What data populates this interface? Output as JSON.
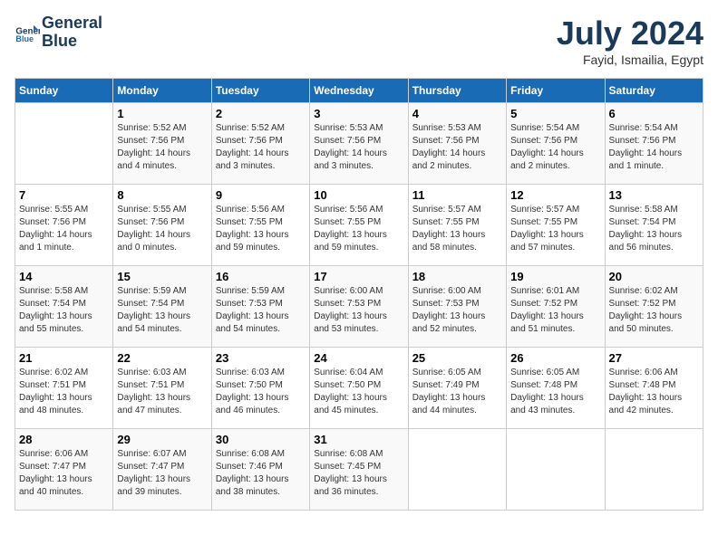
{
  "header": {
    "logo_line1": "General",
    "logo_line2": "Blue",
    "month": "July 2024",
    "location": "Fayid, Ismailia, Egypt"
  },
  "columns": [
    "Sunday",
    "Monday",
    "Tuesday",
    "Wednesday",
    "Thursday",
    "Friday",
    "Saturday"
  ],
  "weeks": [
    [
      {
        "day": "",
        "info": ""
      },
      {
        "day": "1",
        "info": "Sunrise: 5:52 AM\nSunset: 7:56 PM\nDaylight: 14 hours\nand 4 minutes."
      },
      {
        "day": "2",
        "info": "Sunrise: 5:52 AM\nSunset: 7:56 PM\nDaylight: 14 hours\nand 3 minutes."
      },
      {
        "day": "3",
        "info": "Sunrise: 5:53 AM\nSunset: 7:56 PM\nDaylight: 14 hours\nand 3 minutes."
      },
      {
        "day": "4",
        "info": "Sunrise: 5:53 AM\nSunset: 7:56 PM\nDaylight: 14 hours\nand 2 minutes."
      },
      {
        "day": "5",
        "info": "Sunrise: 5:54 AM\nSunset: 7:56 PM\nDaylight: 14 hours\nand 2 minutes."
      },
      {
        "day": "6",
        "info": "Sunrise: 5:54 AM\nSunset: 7:56 PM\nDaylight: 14 hours\nand 1 minute."
      }
    ],
    [
      {
        "day": "7",
        "info": "Sunrise: 5:55 AM\nSunset: 7:56 PM\nDaylight: 14 hours\nand 1 minute."
      },
      {
        "day": "8",
        "info": "Sunrise: 5:55 AM\nSunset: 7:56 PM\nDaylight: 14 hours\nand 0 minutes."
      },
      {
        "day": "9",
        "info": "Sunrise: 5:56 AM\nSunset: 7:55 PM\nDaylight: 13 hours\nand 59 minutes."
      },
      {
        "day": "10",
        "info": "Sunrise: 5:56 AM\nSunset: 7:55 PM\nDaylight: 13 hours\nand 59 minutes."
      },
      {
        "day": "11",
        "info": "Sunrise: 5:57 AM\nSunset: 7:55 PM\nDaylight: 13 hours\nand 58 minutes."
      },
      {
        "day": "12",
        "info": "Sunrise: 5:57 AM\nSunset: 7:55 PM\nDaylight: 13 hours\nand 57 minutes."
      },
      {
        "day": "13",
        "info": "Sunrise: 5:58 AM\nSunset: 7:54 PM\nDaylight: 13 hours\nand 56 minutes."
      }
    ],
    [
      {
        "day": "14",
        "info": "Sunrise: 5:58 AM\nSunset: 7:54 PM\nDaylight: 13 hours\nand 55 minutes."
      },
      {
        "day": "15",
        "info": "Sunrise: 5:59 AM\nSunset: 7:54 PM\nDaylight: 13 hours\nand 54 minutes."
      },
      {
        "day": "16",
        "info": "Sunrise: 5:59 AM\nSunset: 7:53 PM\nDaylight: 13 hours\nand 54 minutes."
      },
      {
        "day": "17",
        "info": "Sunrise: 6:00 AM\nSunset: 7:53 PM\nDaylight: 13 hours\nand 53 minutes."
      },
      {
        "day": "18",
        "info": "Sunrise: 6:00 AM\nSunset: 7:53 PM\nDaylight: 13 hours\nand 52 minutes."
      },
      {
        "day": "19",
        "info": "Sunrise: 6:01 AM\nSunset: 7:52 PM\nDaylight: 13 hours\nand 51 minutes."
      },
      {
        "day": "20",
        "info": "Sunrise: 6:02 AM\nSunset: 7:52 PM\nDaylight: 13 hours\nand 50 minutes."
      }
    ],
    [
      {
        "day": "21",
        "info": "Sunrise: 6:02 AM\nSunset: 7:51 PM\nDaylight: 13 hours\nand 48 minutes."
      },
      {
        "day": "22",
        "info": "Sunrise: 6:03 AM\nSunset: 7:51 PM\nDaylight: 13 hours\nand 47 minutes."
      },
      {
        "day": "23",
        "info": "Sunrise: 6:03 AM\nSunset: 7:50 PM\nDaylight: 13 hours\nand 46 minutes."
      },
      {
        "day": "24",
        "info": "Sunrise: 6:04 AM\nSunset: 7:50 PM\nDaylight: 13 hours\nand 45 minutes."
      },
      {
        "day": "25",
        "info": "Sunrise: 6:05 AM\nSunset: 7:49 PM\nDaylight: 13 hours\nand 44 minutes."
      },
      {
        "day": "26",
        "info": "Sunrise: 6:05 AM\nSunset: 7:48 PM\nDaylight: 13 hours\nand 43 minutes."
      },
      {
        "day": "27",
        "info": "Sunrise: 6:06 AM\nSunset: 7:48 PM\nDaylight: 13 hours\nand 42 minutes."
      }
    ],
    [
      {
        "day": "28",
        "info": "Sunrise: 6:06 AM\nSunset: 7:47 PM\nDaylight: 13 hours\nand 40 minutes."
      },
      {
        "day": "29",
        "info": "Sunrise: 6:07 AM\nSunset: 7:47 PM\nDaylight: 13 hours\nand 39 minutes."
      },
      {
        "day": "30",
        "info": "Sunrise: 6:08 AM\nSunset: 7:46 PM\nDaylight: 13 hours\nand 38 minutes."
      },
      {
        "day": "31",
        "info": "Sunrise: 6:08 AM\nSunset: 7:45 PM\nDaylight: 13 hours\nand 36 minutes."
      },
      {
        "day": "",
        "info": ""
      },
      {
        "day": "",
        "info": ""
      },
      {
        "day": "",
        "info": ""
      }
    ]
  ]
}
